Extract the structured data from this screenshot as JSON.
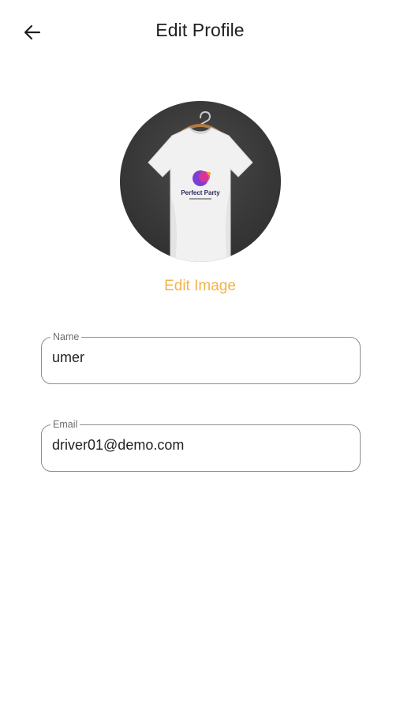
{
  "header": {
    "title": "Edit Profile",
    "back_icon": "arrow-left-icon"
  },
  "profile_image": {
    "edit_label": "Edit Image",
    "edit_color": "#f3b24a",
    "shirt_brand": "Perfect Party"
  },
  "form": {
    "name": {
      "label": "Name",
      "value": "umer"
    },
    "email": {
      "label": "Email",
      "value": "driver01@demo.com"
    }
  }
}
